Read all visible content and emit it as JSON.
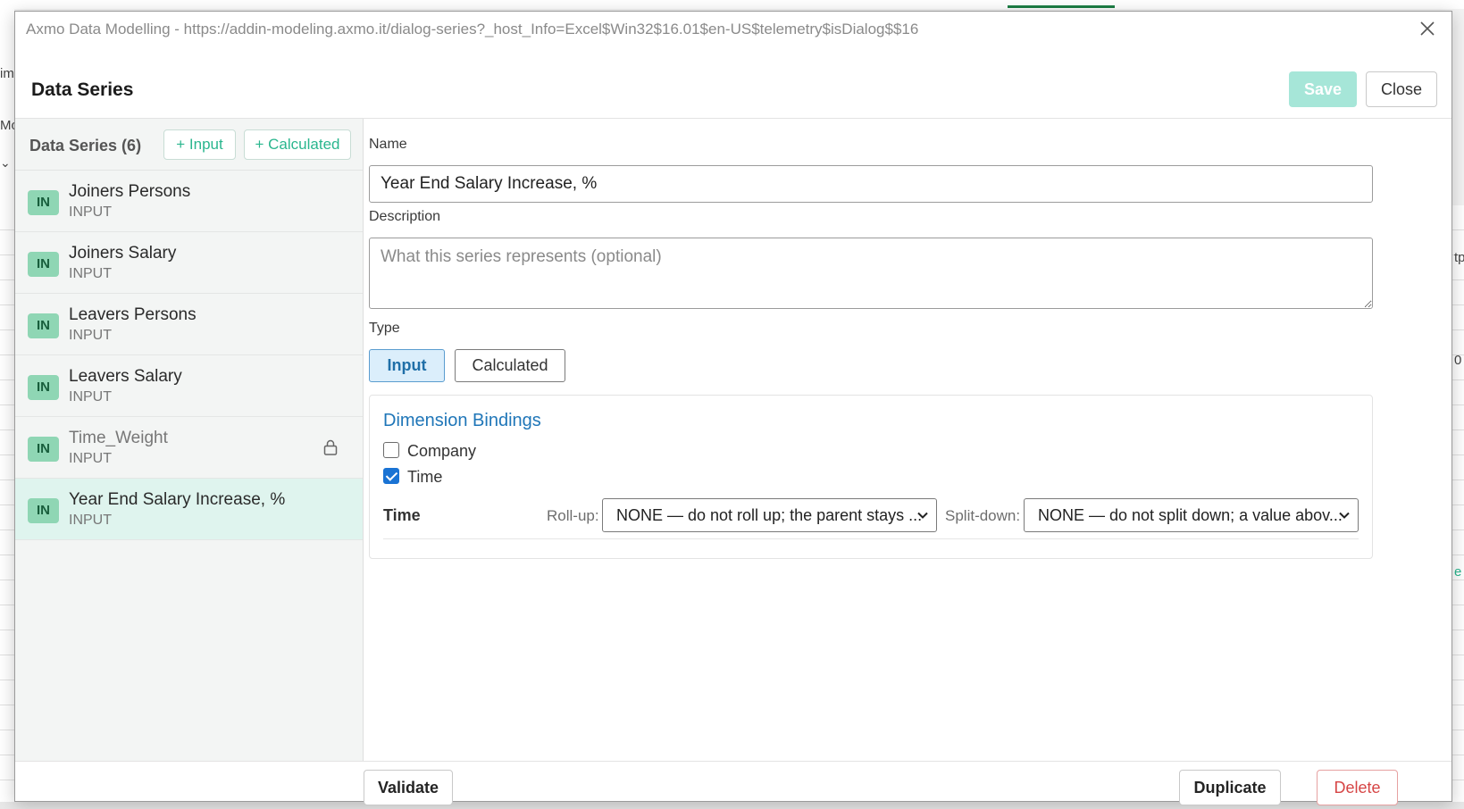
{
  "window": {
    "title": "Axmo Data Modelling - https://addin-modeling.axmo.it/dialog-series?_host_Info=Excel$Win32$16.01$en-US$telemetry$isDialog$$16"
  },
  "header": {
    "title": "Data Series",
    "save_label": "Save",
    "close_label": "Close"
  },
  "sidebar": {
    "title": "Data Series (6)",
    "add_input_label": "+ Input",
    "add_calculated_label": "+ Calculated",
    "items": [
      {
        "badge": "IN",
        "name": "Joiners Persons",
        "type": "INPUT"
      },
      {
        "badge": "IN",
        "name": "Joiners Salary",
        "type": "INPUT"
      },
      {
        "badge": "IN",
        "name": "Leavers Persons",
        "type": "INPUT"
      },
      {
        "badge": "IN",
        "name": "Leavers Salary",
        "type": "INPUT"
      },
      {
        "badge": "IN",
        "name": "Time_Weight",
        "type": "INPUT",
        "locked": true,
        "icon": "lock-icon"
      },
      {
        "badge": "IN",
        "name": "Year End Salary Increase, %",
        "type": "INPUT",
        "selected": true
      }
    ]
  },
  "form": {
    "name_label": "Name",
    "name_value": "Year End Salary Increase, %",
    "description_label": "Description",
    "description_placeholder": "What this series represents (optional)",
    "type_label": "Type",
    "type_input_label": "Input",
    "type_calculated_label": "Calculated",
    "selected_type": "Input"
  },
  "bindings": {
    "title": "Dimension Bindings",
    "dimensions": [
      {
        "label": "Company",
        "checked": false
      },
      {
        "label": "Time",
        "checked": true
      }
    ],
    "rows": [
      {
        "dimension": "Time",
        "rollup_label": "Roll-up:",
        "rollup_value": "NONE — do not roll up; the parent stays ...",
        "splitdown_label": "Split-down:",
        "splitdown_value": "NONE — do not split down; a value abov..."
      }
    ]
  },
  "footer": {
    "validate_label": "Validate",
    "duplicate_label": "Duplicate",
    "delete_label": "Delete"
  },
  "background": {
    "fragment_1": "im",
    "fragment_2": "Mo",
    "fragment_3": "tp",
    "fragment_4": "0",
    "fragment_5": "e"
  },
  "colors": {
    "accent_green": "#2ab68e",
    "save_disabled": "#a6e6d8",
    "selected_row": "#dff4ee",
    "badge": "#8fd6b4",
    "link_blue": "#1f76b8",
    "delete_red": "#d64545"
  }
}
